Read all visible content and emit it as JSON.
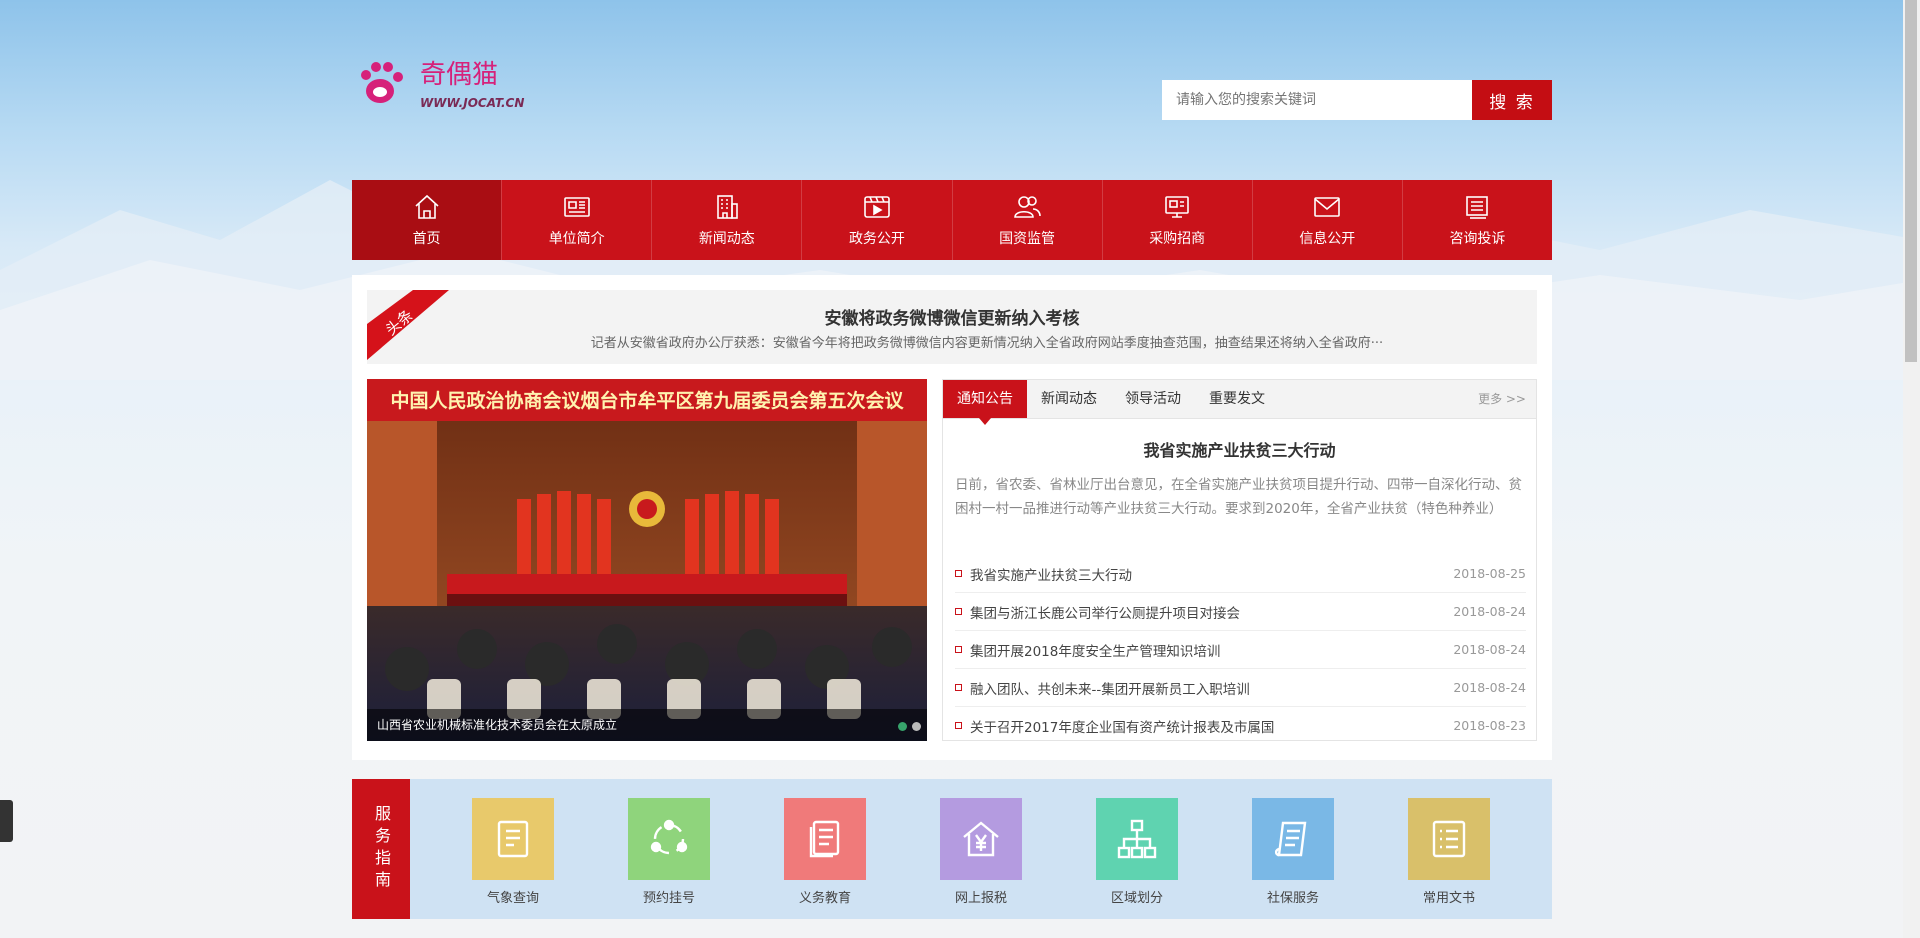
{
  "logo": {
    "brand": "奇偶猫",
    "url": "WWW.JOCAT.CN"
  },
  "search": {
    "placeholder": "请输入您的搜索关键词",
    "button": "搜 索"
  },
  "nav": [
    {
      "label": "首页",
      "icon": "home-icon"
    },
    {
      "label": "单位简介",
      "icon": "newspaper-icon"
    },
    {
      "label": "新闻动态",
      "icon": "building-icon"
    },
    {
      "label": "政务公开",
      "icon": "video-icon"
    },
    {
      "label": "国资监管",
      "icon": "users-icon"
    },
    {
      "label": "采购招商",
      "icon": "chart-board-icon"
    },
    {
      "label": "信息公开",
      "icon": "mail-icon"
    },
    {
      "label": "咨询投诉",
      "icon": "document-icon"
    }
  ],
  "headline": {
    "badge": "头条",
    "title": "安徽将政务微博微信更新纳入考核",
    "desc": "记者从安徽省政府办公厅获悉：安徽省今年将把政务微博微信内容更新情况纳入全省政府网站季度抽查范围，抽查结果还将纳入全省政府···"
  },
  "slider": {
    "banner": "中国人民政治协商会议烟台市牟平区第九届委员会第五次会议",
    "caption": "山西省农业机械标准化技术委员会在太原成立",
    "active_slide": 1,
    "slide_count": 2
  },
  "news": {
    "tabs": [
      "通知公告",
      "新闻动态",
      "领导活动",
      "重要发文"
    ],
    "active_tab": 0,
    "more": "更多 >>",
    "feature_title": "我省实施产业扶贫三大行动",
    "feature_desc": "日前，省农委、省林业厅出台意见，在全省实施产业扶贫项目提升行动、四带一自深化行动、贫困村一村一品推进行动等产业扶贫三大行动。要求到2020年，全省产业扶贫（特色种养业）",
    "items": [
      {
        "title": "我省实施产业扶贫三大行动",
        "date": "2018-08-25"
      },
      {
        "title": "集团与浙江长鹿公司举行公厕提升项目对接会",
        "date": "2018-08-24"
      },
      {
        "title": "集团开展2018年度安全生产管理知识培训",
        "date": "2018-08-24"
      },
      {
        "title": "融入团队、共创未来--集团开展新员工入职培训",
        "date": "2018-08-24"
      },
      {
        "title": "关于召开2017年度企业国有资产统计报表及市属国",
        "date": "2018-08-23"
      }
    ]
  },
  "service": {
    "label": "服务指南",
    "items": [
      {
        "name": "气象查询",
        "color": "#e8c96b",
        "icon": "notepad-icon"
      },
      {
        "name": "预约挂号",
        "color": "#8fd47c",
        "icon": "connect-icon"
      },
      {
        "name": "义务教育",
        "color": "#f07a7a",
        "icon": "book-icon"
      },
      {
        "name": "网上报税",
        "color": "#b49be0",
        "icon": "house-yuan-icon"
      },
      {
        "name": "区域划分",
        "color": "#5fd3b0",
        "icon": "hierarchy-icon"
      },
      {
        "name": "社保服务",
        "color": "#7ab8e6",
        "icon": "scroll-icon"
      },
      {
        "name": "常用文书",
        "color": "#d9c06a",
        "icon": "list-icon"
      }
    ]
  }
}
